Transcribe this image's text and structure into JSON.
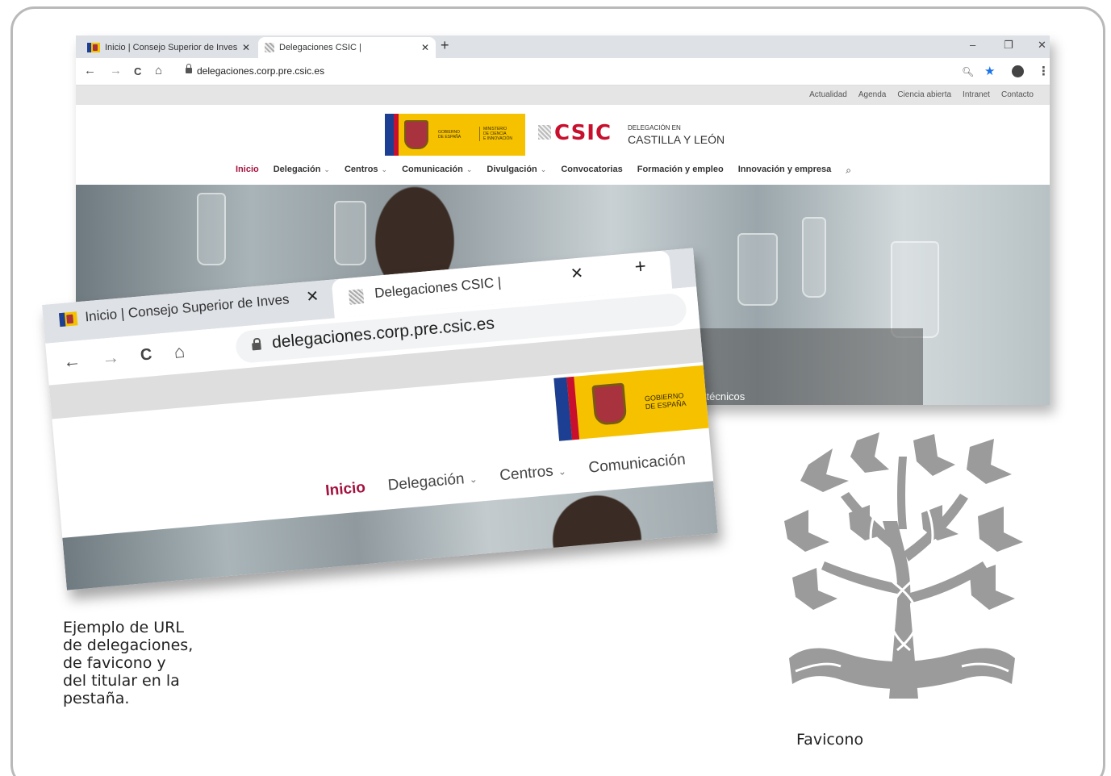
{
  "browser": {
    "tabs": [
      {
        "label": "Inicio | Consejo Superior de Inves",
        "close": "✕"
      },
      {
        "label": "Delegaciones CSIC |",
        "close": "✕"
      }
    ],
    "new_tab": "+",
    "window_controls": {
      "minimize": "–",
      "restore": "❐",
      "close": "✕"
    },
    "url": "delegaciones.corp.pre.csic.es",
    "nav_icons": {
      "back": "←",
      "forward": "→",
      "reload": "C",
      "home": "⌂"
    },
    "addr_icons": {
      "zoom": "zoom-icon",
      "star": "★",
      "profile": "profile-icon",
      "menu": "⋮"
    },
    "accent_star_color": "#1a73e8"
  },
  "site": {
    "top_links": [
      "Actualidad",
      "Agenda",
      "Ciencia abierta",
      "Intranet",
      "Contacto"
    ],
    "gov_logo": {
      "line1": "GOBIERNO",
      "line2": "DE ESPAÑA",
      "ministry1": "MINISTERIO",
      "ministry2": "DE CIENCIA",
      "ministry3": "E INNOVACIÓN"
    },
    "csic": "CSIC",
    "delegation_small": "DELEGACIÓN EN",
    "delegation_big": "CASTILLA Y LEÓN",
    "nav": [
      "Inicio",
      "Delegación",
      "Centros",
      "Comunicación",
      "Divulgación",
      "Convocatorias",
      "Formación y empleo",
      "Innovación y empresa"
    ],
    "hero_text": "o-técnicos",
    "brand_red": "#a4123f"
  },
  "zoom": {
    "tab_inactive": "Inicio | Consejo Superior de Inves",
    "tab_active": "Delegaciones CSIC |",
    "close": "✕",
    "new_tab": "+",
    "url": "delegaciones.corp.pre.csic.es",
    "gov_line1": "GOBIERNO",
    "gov_line2": "DE ESPAÑA",
    "nav": [
      "Inicio",
      "Delegación",
      "Centros",
      "Comunicación"
    ]
  },
  "caption": {
    "lines": [
      "Ejemplo de URL",
      "de delegaciones,",
      "de favicono y",
      "del titular en la",
      "pestaña."
    ]
  },
  "favicon": {
    "label": "Favicono",
    "color": "#9b9b9b"
  }
}
